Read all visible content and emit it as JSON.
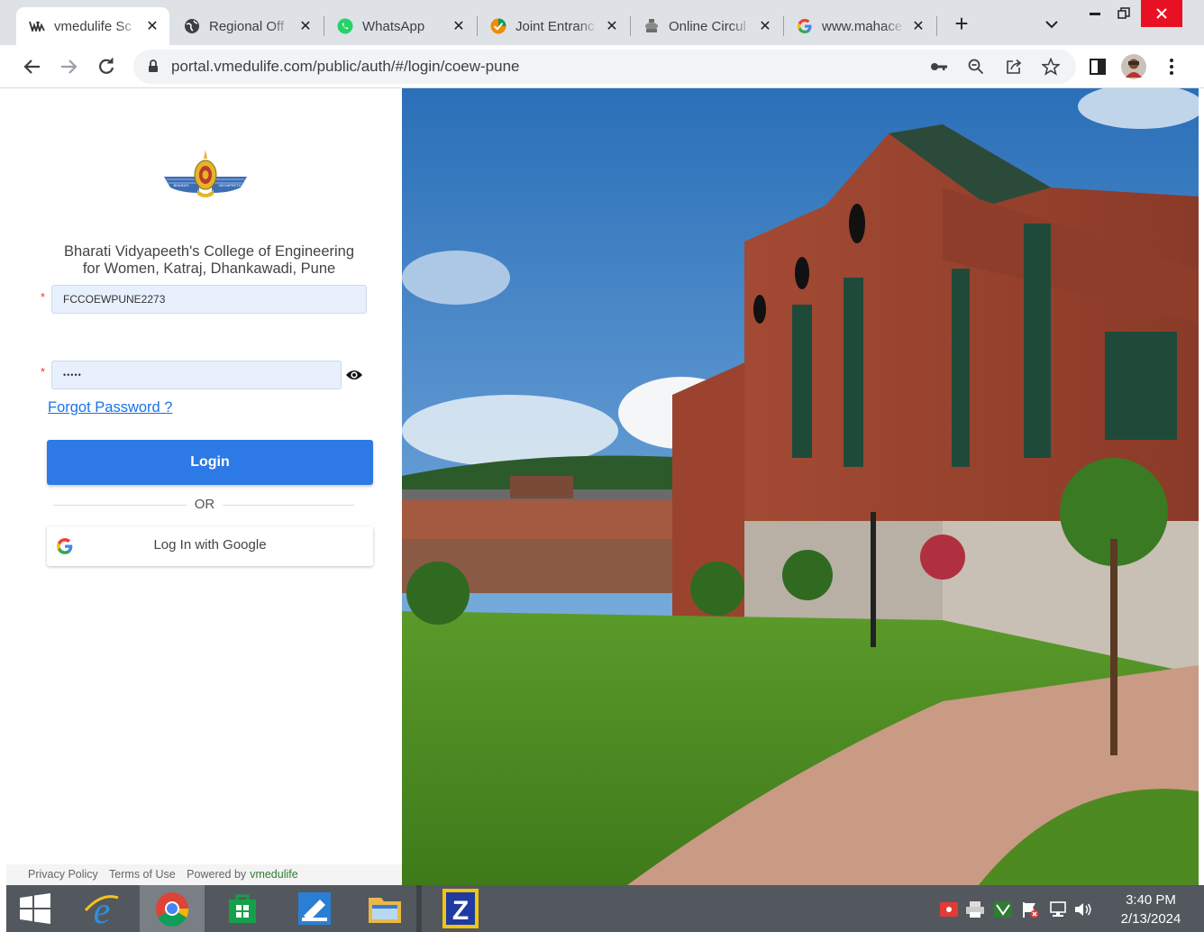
{
  "browser": {
    "tabs": [
      {
        "title": "vmedulife Sc",
        "icon": "vmedulife-icon"
      },
      {
        "title": "Regional Off",
        "icon": "globe-icon"
      },
      {
        "title": "WhatsApp",
        "icon": "whatsapp-icon"
      },
      {
        "title": "Joint Entranc",
        "icon": "checkmark-icon"
      },
      {
        "title": "Online Circul",
        "icon": "emblem-icon"
      },
      {
        "title": "www.mahace",
        "icon": "google-icon"
      }
    ],
    "url": "portal.vmedulife.com/public/auth/#/login/coew-pune"
  },
  "login": {
    "logo_left_text": "BHARATI",
    "logo_right_text": "VIDYAPEETH",
    "college_line1": "Bharati Vidyapeeth's College of Engineering",
    "college_line2": "for Women, Katraj, Dhankawadi, Pune",
    "username_value": "FCCOEWPUNE2273",
    "password_value": "•••••",
    "forgot_label": "Forgot Password ?",
    "login_label": "Login",
    "or_label": "OR",
    "google_label": "Log In with Google"
  },
  "footer": {
    "privacy": "Privacy Policy",
    "terms": "Terms of Use",
    "powered_by": "Powered by",
    "brand": "vmedulife"
  },
  "taskbar": {
    "time": "3:40 PM",
    "date": "2/13/2024"
  },
  "colors": {
    "primary_button": "#2d79e6",
    "link": "#1a73e8",
    "required_star": "#e53935"
  }
}
